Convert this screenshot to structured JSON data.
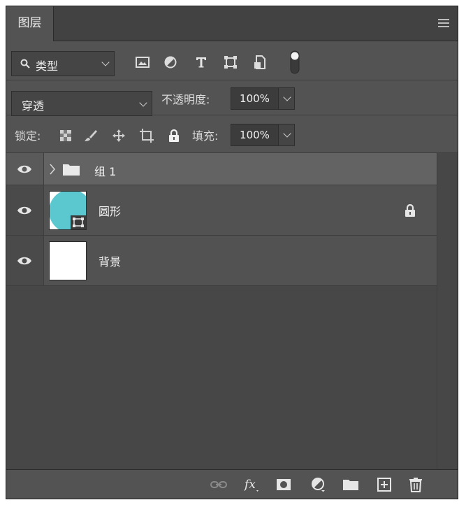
{
  "panel": {
    "tab_label": "图层"
  },
  "filter": {
    "kind_label": "类型"
  },
  "blend": {
    "mode": "穿透",
    "opacity_label": "不透明度:",
    "opacity_value": "100%"
  },
  "lock": {
    "label": "锁定:",
    "fill_label": "填充:",
    "fill_value": "100%"
  },
  "layers": [
    {
      "name": "组 1",
      "type": "group"
    },
    {
      "name": "圆形",
      "type": "shape",
      "locked": true,
      "thumb_color": "#5bc8d0"
    },
    {
      "name": "背景",
      "type": "background"
    }
  ],
  "colors": {
    "panel": "#535353",
    "list": "#474747",
    "selected_row": "#636363",
    "accent_shape": "#5bc8d0"
  }
}
